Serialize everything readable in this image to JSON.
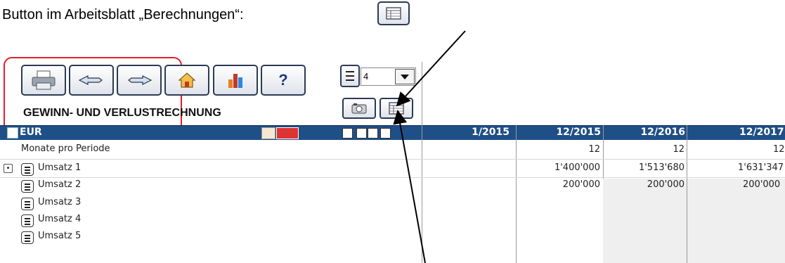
{
  "caption": {
    "line1": "Button im Arbeitsblatt „Berechnungen“:"
  },
  "toolbar": {
    "buttons": [
      {
        "name": "print-icon"
      },
      {
        "name": "hand-back-icon"
      },
      {
        "name": "hand-forward-icon"
      },
      {
        "name": "home-icon"
      },
      {
        "name": "bar-chart-icon"
      },
      {
        "name": "help-icon",
        "label": "?"
      }
    ],
    "period_select_value": "4",
    "title": "GEWINN- UND VERLUSTRECHNUNG"
  },
  "table": {
    "currency": "EUR",
    "columns": [
      "1/2015",
      "12/2015",
      "12/2016",
      "12/2017"
    ],
    "rows": [
      {
        "label": "Monate pro Periode",
        "values": [
          "",
          "12",
          "12",
          "12"
        ]
      },
      {
        "label": "Umsatz 1",
        "values": [
          "",
          "1'400'000",
          "1'513'680",
          "1'631'347"
        ]
      },
      {
        "label": "Umsatz 2",
        "values": [
          "",
          "200'000",
          "200'000",
          "200'000"
        ]
      },
      {
        "label": "Umsatz 3",
        "values": [
          "",
          "",
          "",
          ""
        ]
      },
      {
        "label": "Umsatz 4",
        "values": [
          "",
          "",
          "",
          ""
        ]
      },
      {
        "label": "Umsatz 5",
        "values": [
          "",
          "",
          "",
          ""
        ]
      }
    ]
  },
  "colors": {
    "header_bg": "#1f4f87",
    "highlight_box": "#e0202a",
    "button_border": "#2b3a55"
  }
}
